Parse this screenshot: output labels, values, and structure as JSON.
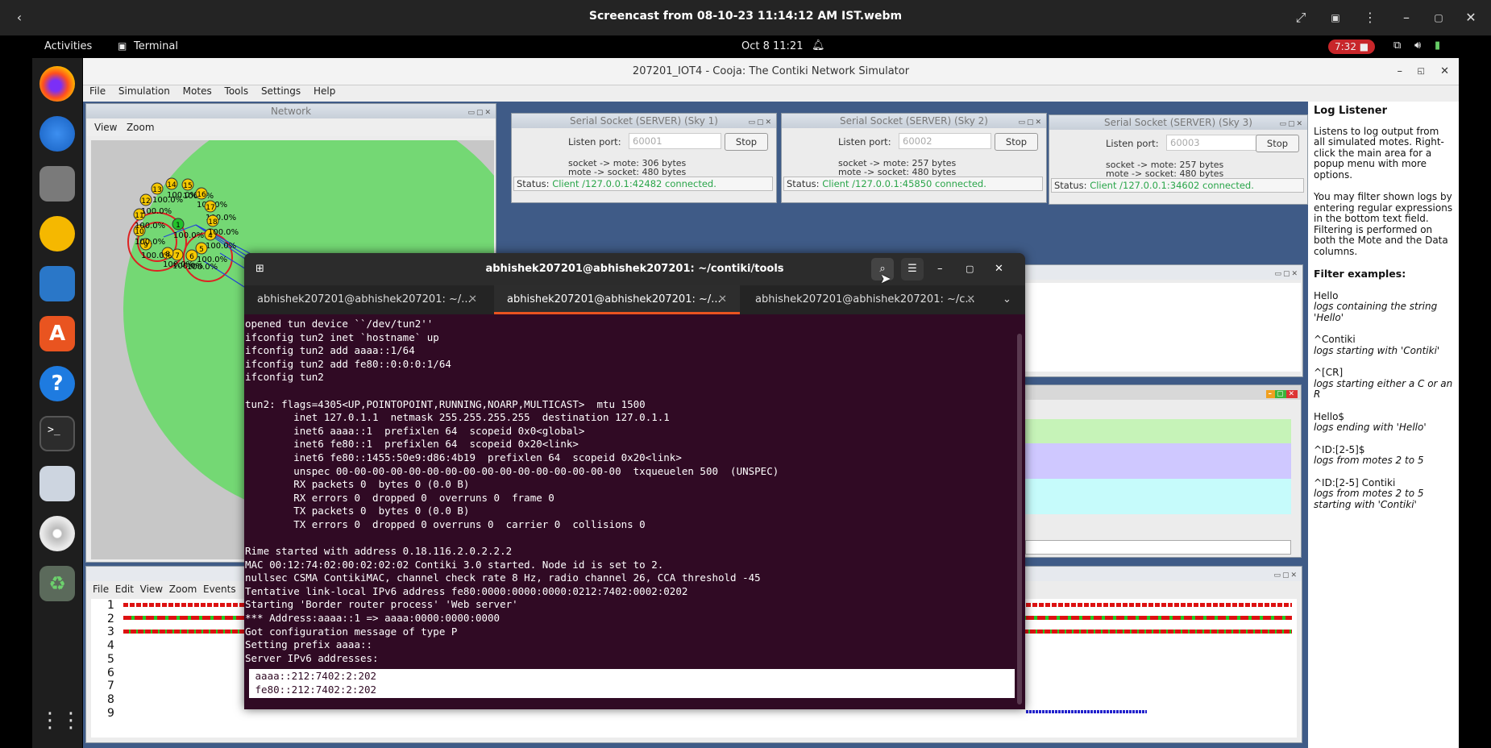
{
  "video": {
    "title": "Screencast from 08-10-23 11:14:12 AM IST.webm"
  },
  "panel": {
    "activities": "Activities",
    "app": "Terminal",
    "clock": "Oct 8  11:21",
    "rec_time": "7:32"
  },
  "cooja": {
    "title": "207201_IOT4 - Cooja: The Contiki Network Simulator",
    "menu": [
      "File",
      "Simulation",
      "Motes",
      "Tools",
      "Settings",
      "Help"
    ]
  },
  "network": {
    "title": "Network",
    "menu": [
      "View",
      "Zoom"
    ],
    "motes": [
      {
        "id": "1",
        "cls": "green"
      },
      {
        "id": "4"
      },
      {
        "id": "5"
      },
      {
        "id": "6"
      },
      {
        "id": "7"
      },
      {
        "id": "8"
      },
      {
        "id": "9"
      },
      {
        "id": "10"
      },
      {
        "id": "11"
      },
      {
        "id": "12"
      },
      {
        "id": "13"
      },
      {
        "id": "14"
      },
      {
        "id": "15"
      },
      {
        "id": "16"
      },
      {
        "id": "17"
      },
      {
        "id": "18"
      }
    ],
    "pct": "100.0%"
  },
  "serial": [
    {
      "title": "Serial Socket (SERVER) (Sky 1)",
      "listen_label": "Listen port:",
      "port": "60001",
      "stop": "Stop",
      "line1": "socket -> mote: 306 bytes",
      "line2": "mote -> socket: 480 bytes",
      "status_label": "Status:",
      "status": "Client /127.0.0.1:42482 connected."
    },
    {
      "title": "Serial Socket (SERVER) (Sky 2)",
      "listen_label": "Listen port:",
      "port": "60002",
      "stop": "Stop",
      "line1": "socket -> mote: 257 bytes",
      "line2": "mote -> socket: 480 bytes",
      "status_label": "Status:",
      "status": "Client /127.0.0.1:45850 connected."
    },
    {
      "title": "Serial Socket (SERVER) (Sky 3)",
      "listen_label": "Listen port:",
      "port": "60003",
      "stop": "Stop",
      "line1": "socket -> mote: 257 bytes",
      "line2": "mote -> socket: 480 bytes",
      "status_label": "Status:",
      "status": "Client /127.0.0.1:34602 connected."
    }
  ],
  "loglistener": {
    "title": "Log Listener",
    "p1": "Listens to log output from all simulated motes. Right-click the main area for a popup menu with more options.",
    "p2": "You may filter shown logs by entering regular expressions in the bottom text field. Filtering is performed on both the Mote and the Data columns.",
    "examples_title": "Filter examples:",
    "examples": [
      {
        "code": "Hello",
        "desc": "logs containing the string 'Hello'"
      },
      {
        "code": "^Contiki",
        "desc": "logs starting with 'Contiki'"
      },
      {
        "code": "^[CR]",
        "desc": "logs starting either a C or an R"
      },
      {
        "code": "Hello$",
        "desc": "logs ending with 'Hello'"
      },
      {
        "code": "^ID:[2-5]$",
        "desc": "logs from motes 2 to 5"
      },
      {
        "code": "^ID:[2-5] Contiki",
        "desc": "logs from motes 2 to 5 starting with 'Contiki'"
      }
    ]
  },
  "timeline": {
    "menu": [
      "File",
      "Edit",
      "View",
      "Zoom",
      "Events"
    ],
    "rows": [
      "1",
      "2",
      "3",
      "4",
      "5",
      "6",
      "7",
      "8",
      "9"
    ]
  },
  "terminal": {
    "title": "abhishek207201@abhishek207201: ~/contiki/tools",
    "tabs": [
      "abhishek207201@abhishek207201: ~/...",
      "abhishek207201@abhishek207201: ~/...",
      "abhishek207201@abhishek207201: ~/c..."
    ],
    "lines": [
      "opened tun device ``/dev/tun2''",
      "ifconfig tun2 inet `hostname` up",
      "ifconfig tun2 add aaaa::1/64",
      "ifconfig tun2 add fe80::0:0:0:1/64",
      "ifconfig tun2",
      "",
      "tun2: flags=4305<UP,POINTOPOINT,RUNNING,NOARP,MULTICAST>  mtu 1500",
      "        inet 127.0.1.1  netmask 255.255.255.255  destination 127.0.1.1",
      "        inet6 aaaa::1  prefixlen 64  scopeid 0x0<global>",
      "        inet6 fe80::1  prefixlen 64  scopeid 0x20<link>",
      "        inet6 fe80::1455:50e9:d86:4b19  prefixlen 64  scopeid 0x20<link>",
      "        unspec 00-00-00-00-00-00-00-00-00-00-00-00-00-00-00-00  txqueuelen 500  (UNSPEC)",
      "        RX packets 0  bytes 0 (0.0 B)",
      "        RX errors 0  dropped 0  overruns 0  frame 0",
      "        TX packets 0  bytes 0 (0.0 B)",
      "        TX errors 0  dropped 0 overruns 0  carrier 0  collisions 0",
      "",
      "Rime started with address 0.18.116.2.0.2.2.2",
      "MAC 00:12:74:02:00:02:02:02 Contiki 3.0 started. Node id is set to 2.",
      "nullsec CSMA ContikiMAC, channel check rate 8 Hz, radio channel 26, CCA threshold -45",
      "Tentative link-local IPv6 address fe80:0000:0000:0000:0212:7402:0002:0202",
      "Starting 'Border router process' 'Web server'",
      "*** Address:aaaa::1 => aaaa:0000:0000:0000",
      "Got configuration message of type P",
      "Setting prefix aaaa::",
      "Server IPv6 addresses:"
    ],
    "sel": [
      " aaaa::212:7402:2:202",
      " fe80::212:7402:2:202"
    ]
  },
  "colors": {
    "terminal_bg": "#300a24",
    "status_ok": "#2aa54a",
    "mote_yellow": "#f6c800",
    "mote_green": "#22c22a"
  }
}
